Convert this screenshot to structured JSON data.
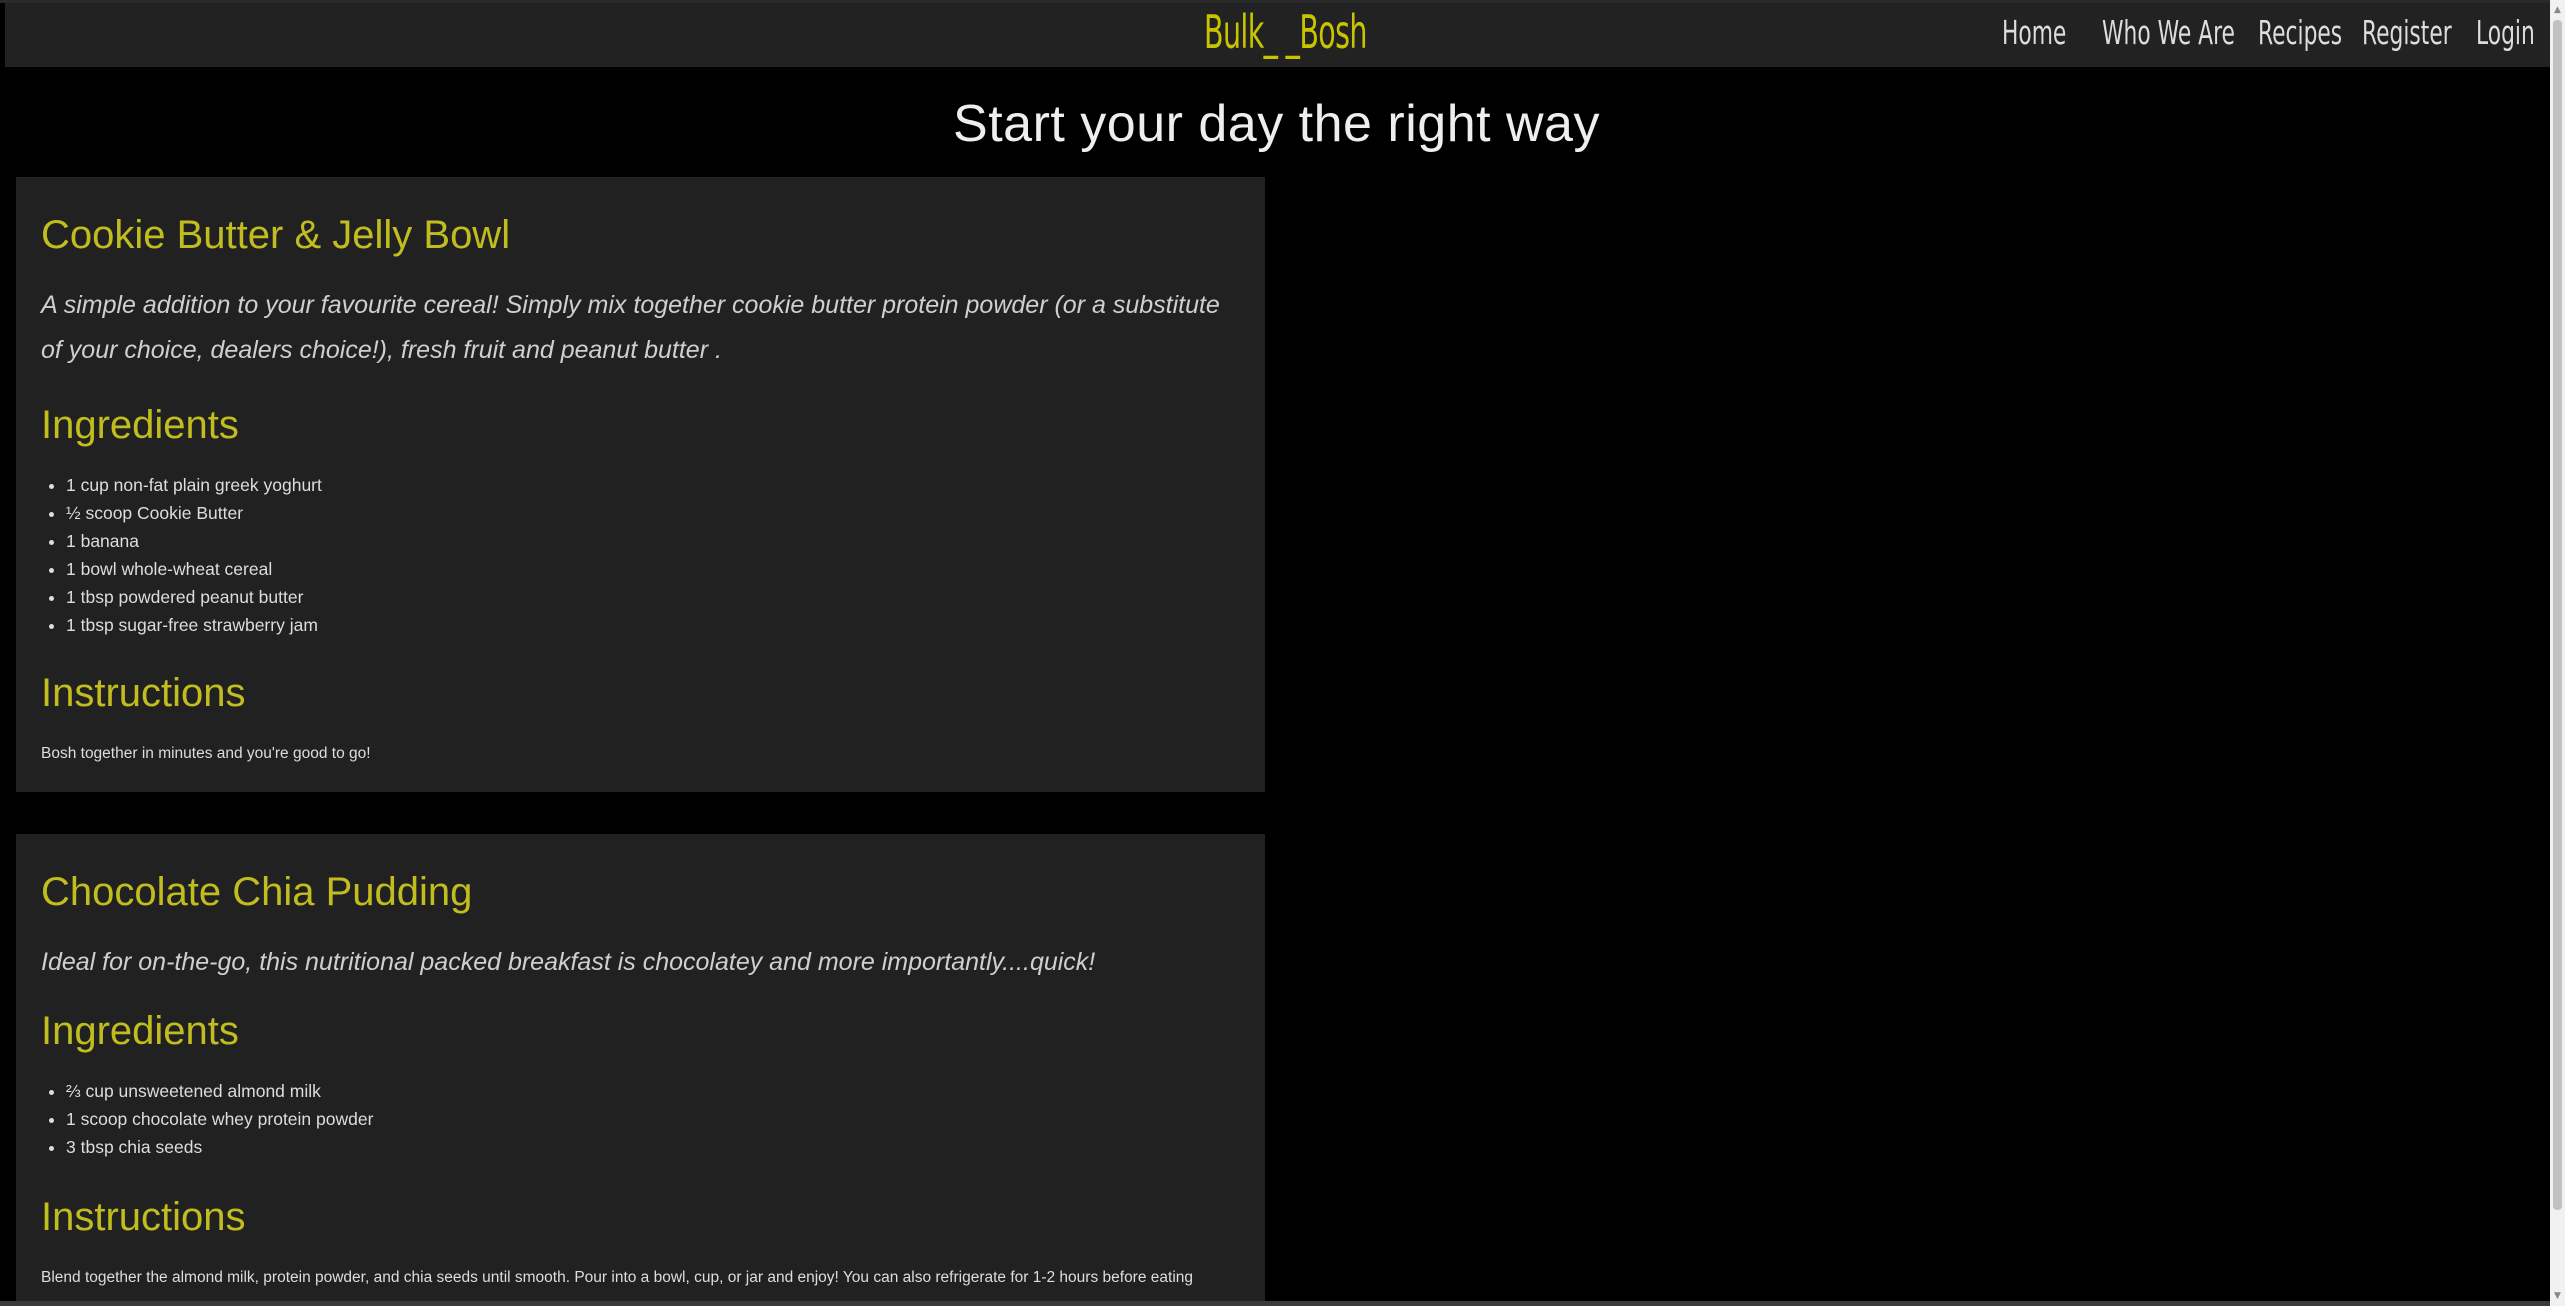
{
  "header": {
    "brand": "Bulk_ _Bosh",
    "nav": [
      {
        "label": "Home"
      },
      {
        "label": "Who We Are"
      },
      {
        "label": "Recipes"
      },
      {
        "label": "Register"
      },
      {
        "label": "Login"
      }
    ]
  },
  "page_title": "Start your day the right way",
  "recipes": [
    {
      "title": "Cookie Butter & Jelly Bowl",
      "description": "A simple addition to your favourite cereal! Simply mix together cookie butter protein powder (or a substitute of your choice, dealers choice!), fresh fruit and peanut butter .",
      "ingredients_heading": "Ingredients",
      "ingredients": [
        "1 cup non-fat plain greek yoghurt",
        "½ scoop Cookie Butter",
        "1 banana",
        "1 bowl whole-wheat cereal",
        "1 tbsp powdered peanut butter",
        "1 tbsp sugar-free strawberry jam"
      ],
      "instructions_heading": "Instructions",
      "instructions": "Bosh together in minutes and you're good to go!"
    },
    {
      "title": "Chocolate Chia Pudding",
      "description": "Ideal for on-the-go, this nutritional packed breakfast is chocolatey and more importantly....quick!",
      "ingredients_heading": "Ingredients",
      "ingredients": [
        "⅔ cup unsweetened almond milk",
        "1 scoop chocolate whey protein powder",
        "3 tbsp chia seeds"
      ],
      "instructions_heading": "Instructions",
      "instructions": "Blend together the almond milk, protein powder, and chia seeds until smooth. Pour into a bowl, cup, or jar and enjoy! You can also refrigerate for 1-2 hours before eating"
    }
  ]
}
